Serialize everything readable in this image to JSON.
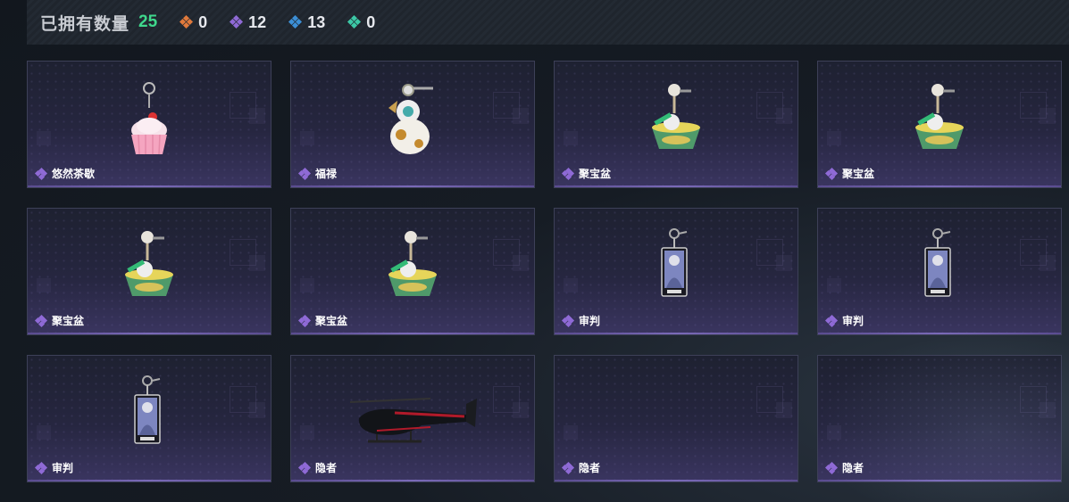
{
  "header": {
    "owned_label": "已拥有数量",
    "owned_count": "25",
    "stats": [
      {
        "icon": "orange-gem-icon",
        "color": "#e07a3c",
        "value": "0"
      },
      {
        "icon": "purple-gem-icon",
        "color": "#8f6ad6",
        "value": "12"
      },
      {
        "icon": "blue-gem-icon",
        "color": "#3c8fd6",
        "value": "13"
      },
      {
        "icon": "teal-gem-icon",
        "color": "#3cc8a6",
        "value": "0"
      }
    ]
  },
  "items": [
    {
      "name": "悠然茶歇",
      "type": "cupcake"
    },
    {
      "name": "福禄",
      "type": "gourd"
    },
    {
      "name": "聚宝盆",
      "type": "bowl"
    },
    {
      "name": "聚宝盆",
      "type": "bowl"
    },
    {
      "name": "聚宝盆",
      "type": "bowl"
    },
    {
      "name": "聚宝盆",
      "type": "bowl"
    },
    {
      "name": "审判",
      "type": "card"
    },
    {
      "name": "审判",
      "type": "card"
    },
    {
      "name": "审判",
      "type": "card"
    },
    {
      "name": "隐者",
      "type": "helicopter"
    },
    {
      "name": "隐者",
      "type": "empty"
    },
    {
      "name": "隐者",
      "type": "empty"
    }
  ],
  "rarity_color": "#8f6ad6"
}
